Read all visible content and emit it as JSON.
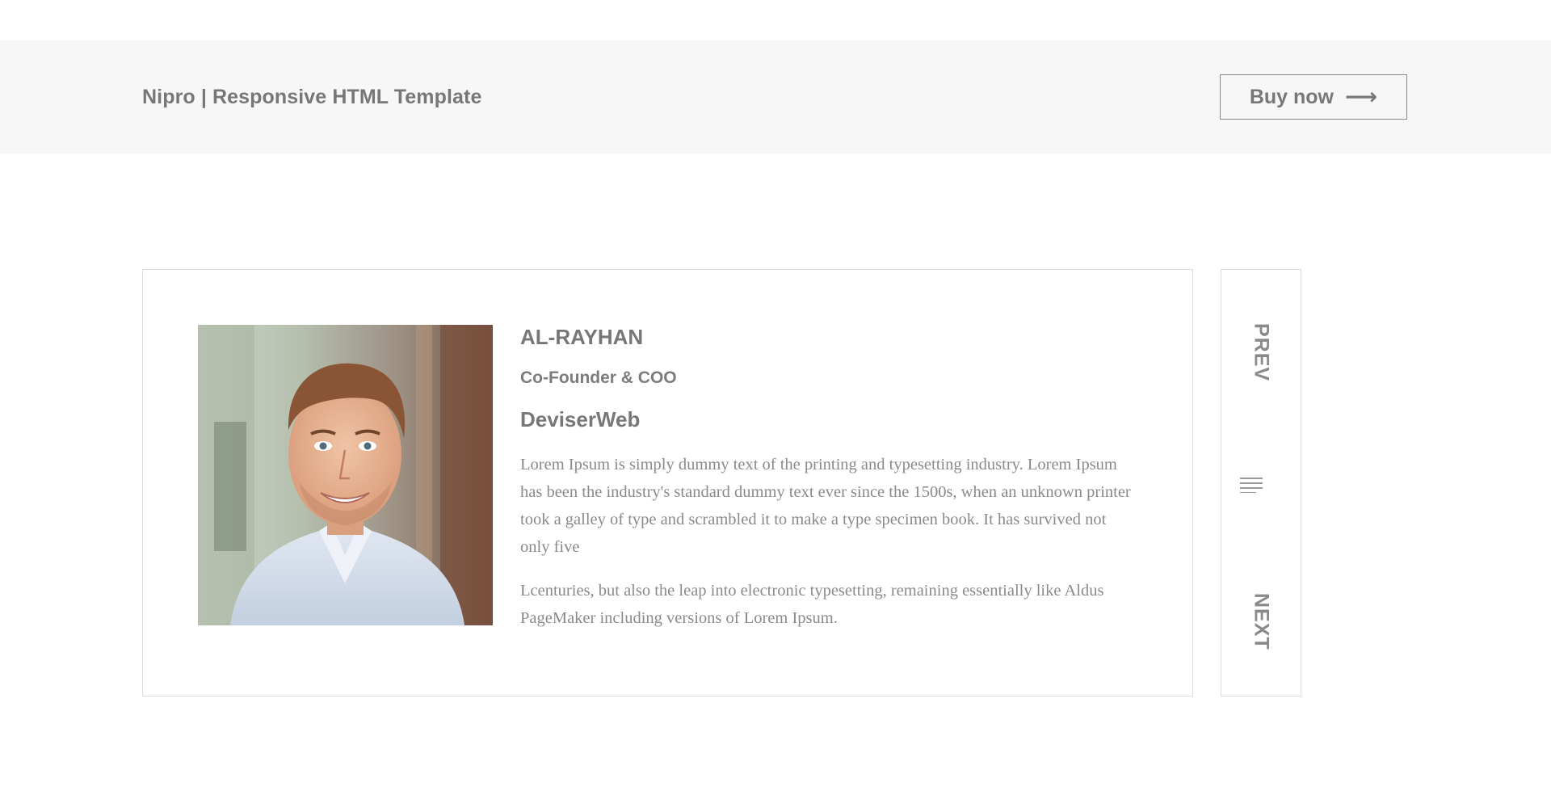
{
  "header": {
    "title": "Nipro | Responsive HTML Template",
    "buy_label": "Buy now",
    "buy_icon": "arrow-right-icon"
  },
  "profile": {
    "name": "AL-RAYHAN",
    "role": "Co-Founder & COO",
    "company": "DeviserWeb",
    "paragraphs": [
      "Lorem Ipsum is simply dummy text of the printing and typesetting industry. Lorem Ipsum has been the industry's standard dummy text ever since the 1500s, when an unknown printer took a galley of type and scrambled it to make a type specimen book. It has survived not only five",
      "Lcenturies, but also the leap into electronic typesetting, remaining essentially like Aldus PageMaker including versions of Lorem Ipsum."
    ]
  },
  "nav": {
    "prev_label": "PREV",
    "next_label": "NEXT",
    "menu_icon": "menu-lines-icon"
  },
  "colors": {
    "topbar_bg": "#f7f7f7",
    "text": "#777777",
    "border": "#dcdcdc"
  }
}
